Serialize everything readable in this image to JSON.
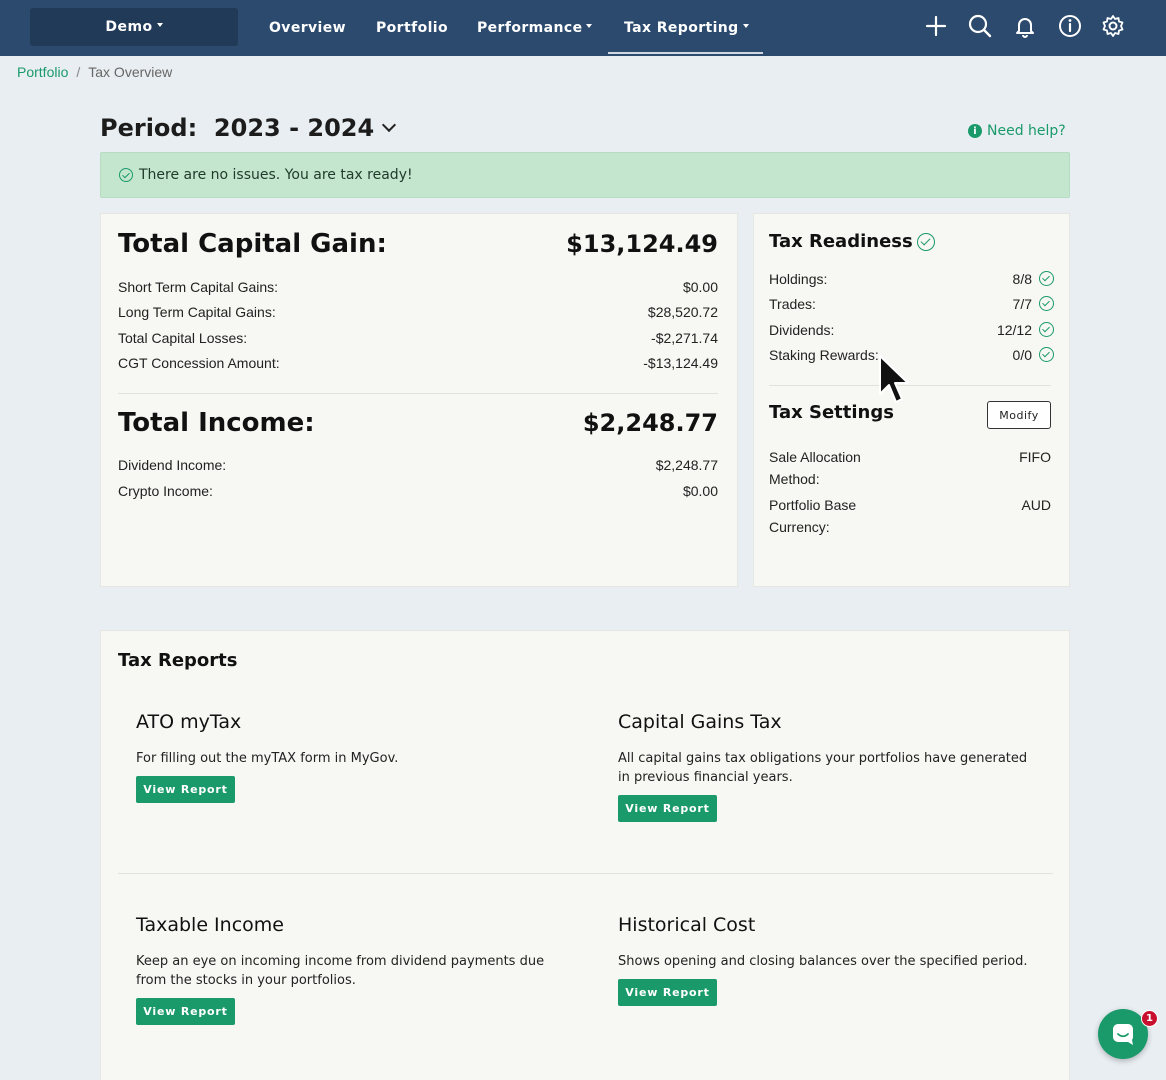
{
  "nav": {
    "portfolio_selector": "Demo",
    "items": [
      {
        "label": "Overview"
      },
      {
        "label": "Portfolio"
      },
      {
        "label": "Performance"
      },
      {
        "label": "Tax Reporting"
      }
    ],
    "icons": [
      "plus-icon",
      "search-icon",
      "bell-icon",
      "info-icon",
      "gear-icon"
    ]
  },
  "breadcrumb": {
    "link": "Portfolio",
    "separator": "/",
    "current": "Tax Overview"
  },
  "period": {
    "label": "Period:",
    "value": "2023 - 2024"
  },
  "help": {
    "label": "Need help?"
  },
  "alert": {
    "text": "There are no issues. You are tax ready!"
  },
  "capital": {
    "title": "Total Capital Gain:",
    "total": "$13,124.49",
    "rows": [
      {
        "label": "Short Term Capital Gains:",
        "value": "$0.00"
      },
      {
        "label": "Long Term Capital Gains:",
        "value": "$28,520.72"
      },
      {
        "label": "Total Capital Losses:",
        "value": "-$2,271.74"
      },
      {
        "label": "CGT Concession Amount:",
        "value": "-$13,124.49"
      }
    ]
  },
  "income": {
    "title": "Total Income:",
    "total": "$2,248.77",
    "rows": [
      {
        "label": "Dividend Income:",
        "value": "$2,248.77"
      },
      {
        "label": "Crypto Income:",
        "value": "$0.00"
      }
    ]
  },
  "readiness": {
    "title": "Tax Readiness",
    "rows": [
      {
        "label": "Holdings:",
        "value": "8/8"
      },
      {
        "label": "Trades:",
        "value": "7/7"
      },
      {
        "label": "Dividends:",
        "value": "12/12"
      },
      {
        "label": "Staking Rewards:",
        "value": "0/0"
      }
    ]
  },
  "settings": {
    "title": "Tax Settings",
    "modify_label": "Modify",
    "rows": [
      {
        "label_line1": "Sale Allocation",
        "label_line2": "Method:",
        "value": "FIFO"
      },
      {
        "label_line1": "Portfolio Base",
        "label_line2": "Currency:",
        "value": "AUD"
      }
    ]
  },
  "reports": {
    "title": "Tax Reports",
    "button_label": "View Report",
    "items": [
      {
        "title": "ATO myTax",
        "desc1": "For filling out the myTAX form in MyGov.",
        "desc2": ""
      },
      {
        "title": "Capital Gains Tax",
        "desc1": "All capital gains tax obligations your portfolios have generated",
        "desc2": "in previous financial years."
      },
      {
        "title": "Taxable Income",
        "desc1": "Keep an eye on incoming income from dividend payments due",
        "desc2": "from the stocks in your portfolios."
      },
      {
        "title": "Historical Cost",
        "desc1": "Shows opening and closing balances over the specified period.",
        "desc2": ""
      }
    ]
  },
  "chat": {
    "badge": "1"
  },
  "colors": {
    "nav": "#2b4a6e",
    "accent": "#1a9a6a",
    "alert_bg": "#c4e6cf",
    "badge": "#c8102e"
  }
}
